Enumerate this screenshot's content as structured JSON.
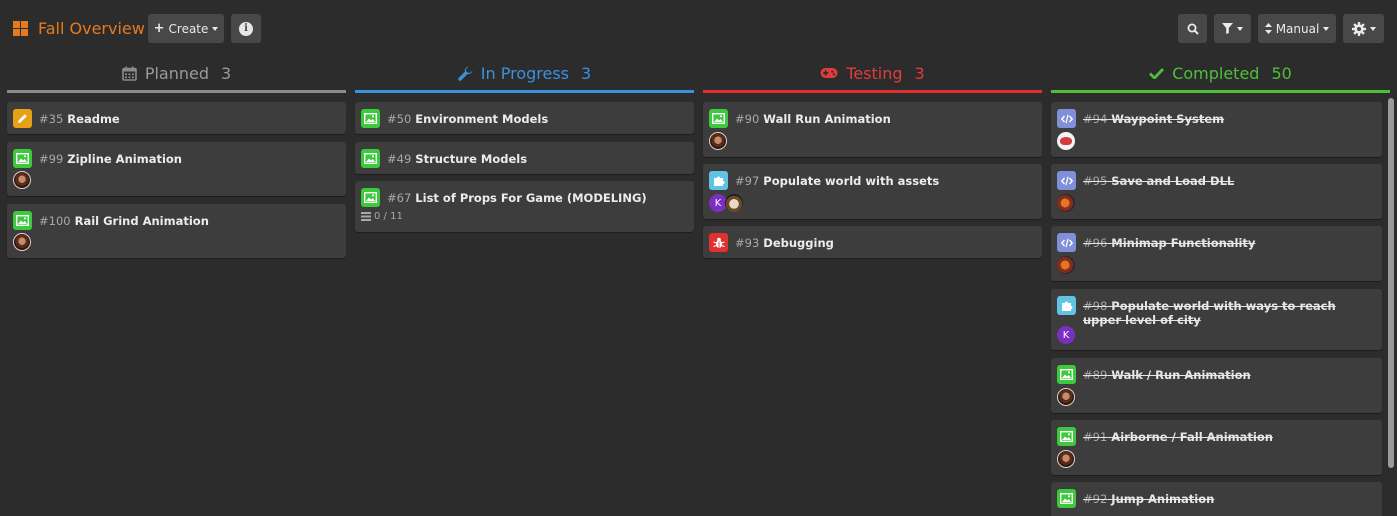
{
  "header": {
    "title": "Fall Overview",
    "create_label": "Create",
    "manual_label": "Manual",
    "icons": {
      "logo": "board-grid-icon",
      "create": "plus-icon",
      "info": "info-icon",
      "search": "search-icon",
      "filter": "filter-icon",
      "sort": "sort-icon",
      "settings": "gear-icon"
    }
  },
  "colors": {
    "accent": "#e77921",
    "planned": "#9a9a9a",
    "in_progress": "#3d8fe0",
    "testing": "#e03c3c",
    "completed": "#4fbf3a",
    "type_art": "#3cc93c",
    "type_doc": "#e6a117",
    "type_code": "#7f8fd8",
    "type_feature": "#5fc3e4",
    "type_bug": "#e03030"
  },
  "columns": [
    {
      "name": "Planned",
      "count": "3",
      "icon": "calendar-icon",
      "cards": [
        {
          "num": "#35",
          "title": "Readme",
          "type": "doc"
        },
        {
          "num": "#99",
          "title": "Zipline Animation",
          "type": "art"
        },
        {
          "num": "#100",
          "title": "Rail Grind Animation",
          "type": "art"
        }
      ]
    },
    {
      "name": "In Progress",
      "count": "3",
      "icon": "wrench-icon",
      "cards": [
        {
          "num": "#50",
          "title": "Environment Models",
          "type": "art"
        },
        {
          "num": "#49",
          "title": "Structure Models",
          "type": "art"
        },
        {
          "num": "#67",
          "title": "List of Props For Game (MODELING)",
          "type": "art",
          "subtasks": "0 / 11"
        }
      ]
    },
    {
      "name": "Testing",
      "count": "3",
      "icon": "gamepad-icon",
      "cards": [
        {
          "num": "#90",
          "title": "Wall Run Animation",
          "type": "art"
        },
        {
          "num": "#97",
          "title": "Populate world with assets",
          "type": "feature",
          "avatar_letter": "K"
        },
        {
          "num": "#93",
          "title": "Debugging",
          "type": "bug"
        }
      ]
    },
    {
      "name": "Completed",
      "count": "50",
      "icon": "check-icon",
      "cards": [
        {
          "num": "#94",
          "title": "Waypoint System",
          "type": "code"
        },
        {
          "num": "#95",
          "title": "Save and Load DLL",
          "type": "code"
        },
        {
          "num": "#96",
          "title": "Minimap Functionality",
          "type": "code"
        },
        {
          "num": "#98",
          "title": "Populate world with ways to reach upper level of city",
          "type": "feature",
          "avatar_letter": "K"
        },
        {
          "num": "#89",
          "title": "Walk / Run Animation",
          "type": "art"
        },
        {
          "num": "#91",
          "title": "Airborne / Fall Animation",
          "type": "art"
        },
        {
          "num": "#92",
          "title": "Jump Animation",
          "type": "art"
        }
      ]
    }
  ]
}
